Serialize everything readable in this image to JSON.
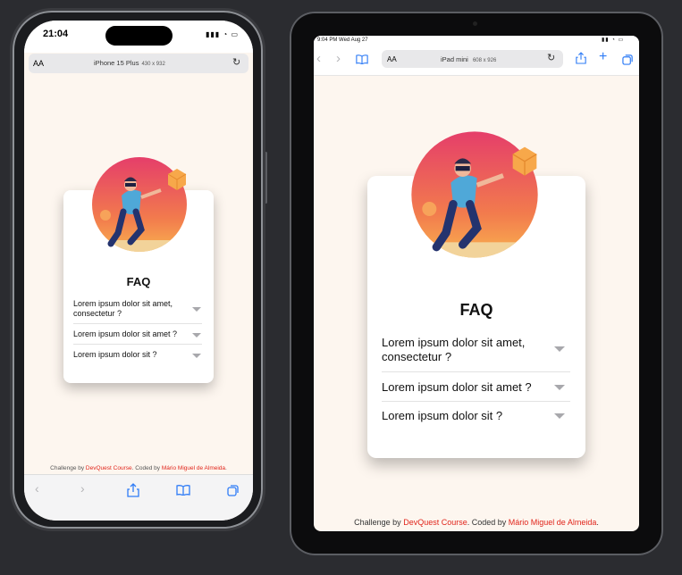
{
  "colors": {
    "accent": "#e1251b",
    "page_bg": "#fdf6ef",
    "desktop_bg": "#2b2c30"
  },
  "iphone": {
    "time": "21:04",
    "text_size_label": "AA",
    "device_name": "iPhone 15 Plus",
    "device_size": "430 x 932",
    "icons": [
      "reload-icon",
      "back-icon",
      "forward-icon",
      "share-icon",
      "bookmarks-icon",
      "tabs-icon"
    ]
  },
  "ipad": {
    "status": "9:04 PM Wed Aug 27",
    "text_size_label": "AA",
    "device_name": "iPad mini",
    "device_size": "608 x 926",
    "icons": [
      "back-icon",
      "forward-icon",
      "bookmarks-icon",
      "reload-icon",
      "share-icon",
      "new-tab-icon",
      "tabs-icon"
    ]
  },
  "faq": {
    "title": "FAQ",
    "questions": [
      "Lorem ipsum dolor sit amet, consectetur ?",
      "Lorem ipsum dolor sit amet ?",
      "Lorem ipsum dolor sit ?"
    ]
  },
  "footer": {
    "challenge_text": "Challenge by",
    "challenge_link": "DevQuest Course",
    "coded_text": ". Coded by",
    "author_link": "Mário Miguel de Almeida",
    "end": "."
  }
}
